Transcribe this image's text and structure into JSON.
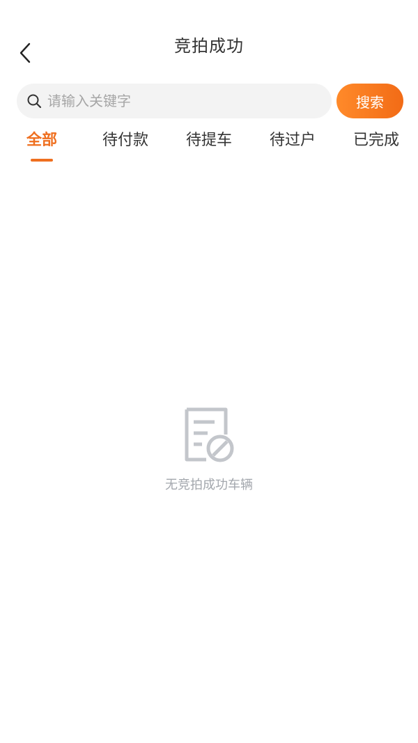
{
  "header": {
    "title": "竞拍成功",
    "back_icon": "chevron-left-icon"
  },
  "search": {
    "placeholder": "请输入关键字",
    "value": "",
    "button_label": "搜索",
    "icon": "search-icon"
  },
  "tabs": [
    {
      "label": "全部",
      "active": true
    },
    {
      "label": "待付款",
      "active": false
    },
    {
      "label": "待提车",
      "active": false
    },
    {
      "label": "待过户",
      "active": false
    },
    {
      "label": "已完成",
      "active": false
    }
  ],
  "empty_state": {
    "icon": "no-document-icon",
    "message": "无竞拍成功车辆"
  },
  "colors": {
    "accent": "#ef6f1f",
    "search_bg": "#f3f3f3",
    "muted_text": "#a3a7ad"
  }
}
